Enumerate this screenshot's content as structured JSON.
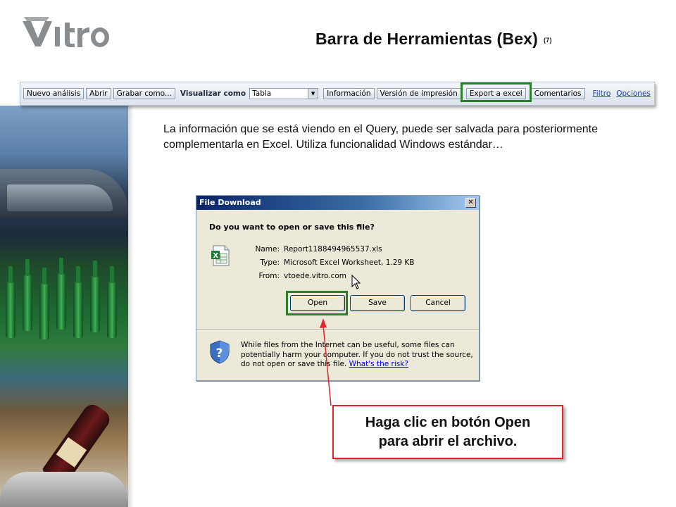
{
  "logo": {
    "text": "Vitro"
  },
  "title": {
    "main": "Barra de Herramientas (Bex)",
    "slide_number": "(7)"
  },
  "toolbar": {
    "buttons": [
      "Nuevo análisis",
      "Abrir",
      "Grabar como..."
    ],
    "view_label": "Visualizar como",
    "view_select": "Tabla",
    "buttons2": [
      "Información",
      "Versión de impresión",
      "Export a excel",
      "Comentarios"
    ],
    "links": [
      "Filtro",
      "Opciones"
    ]
  },
  "description": "La información que se está viendo en el Query, puede ser salvada para posteriormente complementarla en Excel. Utiliza funcionalidad Windows estándar…",
  "dialog": {
    "title": "File Download",
    "close": "✕",
    "question": "Do you want to open or save this file?",
    "name_label": "Name:",
    "name_value": "Report1188494965537.xls",
    "type_label": "Type:",
    "type_value": "Microsoft Excel Worksheet, 1.29 KB",
    "from_label": "From:",
    "from_value": "vtoede.vitro.com",
    "open_button": "Open",
    "save_button": "Save",
    "cancel_button": "Cancel",
    "warning_text": "While files from the Internet can be useful, some files can potentially harm your computer. If you do not trust the source, do not open or save this file.",
    "risk_link": "What's the risk?"
  },
  "callout": {
    "line1": "Haga clic en botón Open",
    "line2": "para abrir el archivo."
  },
  "colors": {
    "highlight": "#2a7f2a",
    "callout_border": "#e0262a",
    "dialog_title": "#0a246a"
  }
}
